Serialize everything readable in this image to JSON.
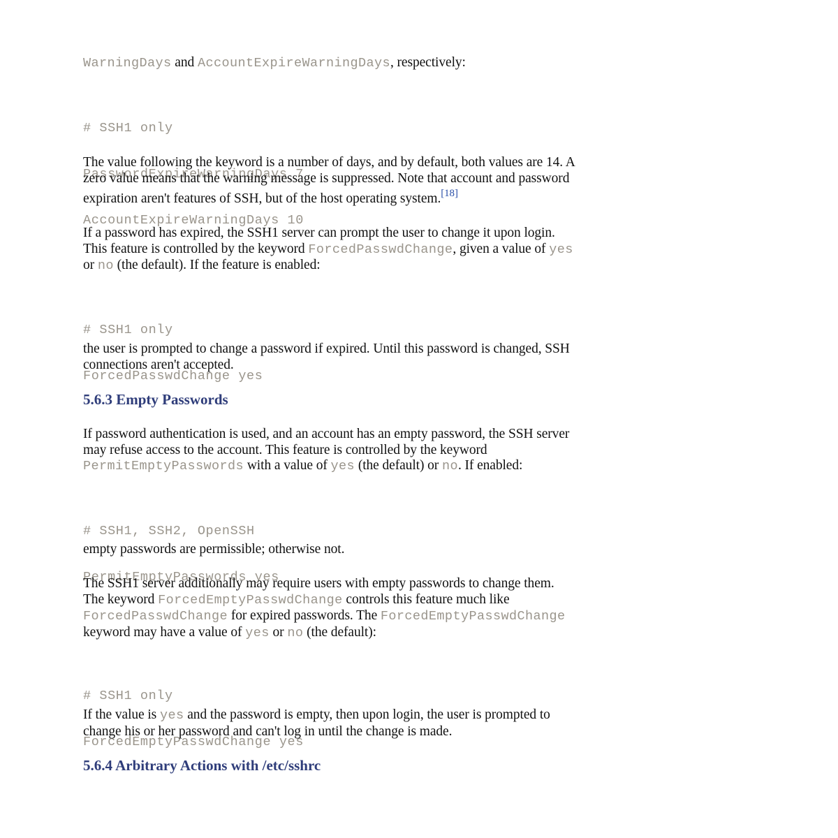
{
  "document": {
    "intro_line": {
      "kw1": "WarningDays",
      "t1": " and ",
      "kw2": "AccountExpireWarningDays",
      "t2": ", respectively:"
    },
    "code1": [
      "# SSH1 only",
      "PasswordExpireWarningDays 7",
      "AccountExpireWarningDays 10"
    ],
    "para1": {
      "lines": [
        "The value following the keyword is a number of days, and by default, both values are 14. A",
        "zero value means that the warning message is suppressed. Note that account and password",
        "expiration aren't features of SSH, but of the host operating system."
      ],
      "footnote": "[18]"
    },
    "para2": {
      "l1": "If a password has expired, the SSH1 server can prompt the user to change it upon login.",
      "l2a": "This feature is controlled by the keyword ",
      "l2kw": "ForcedPasswdChange",
      "l2b": ", given a value of ",
      "l2yes": "yes",
      "l3a": "or ",
      "l3no": "no",
      "l3b": " (the default). If the feature is enabled:"
    },
    "code2": [
      "# SSH1 only",
      "ForcedPasswdChange yes"
    ],
    "para3": [
      "the user is prompted to change a password if expired. Until this password is changed, SSH",
      "connections aren't accepted."
    ],
    "heading1": "5.6.3 Empty Passwords",
    "para4": {
      "l1": "If password authentication is used, and an account has an empty password, the SSH server",
      "l2": "may refuse access to the account. This feature is controlled by the keyword",
      "l3kw": "PermitEmptyPasswords",
      "l3a": " with a value of ",
      "l3yes": "yes",
      "l3b": " (the default) or ",
      "l3no": "no",
      "l3c": ". If enabled:"
    },
    "code3": [
      "# SSH1, SSH2, OpenSSH",
      "PermitEmptyPasswords yes"
    ],
    "para5": "empty passwords are permissible; otherwise not.",
    "para6": {
      "l1": "The SSH1 server additionally may require users with empty passwords to change them.",
      "l2a": "The keyword ",
      "l2kw": "ForcedEmptyPasswdChange",
      "l2b": " controls this feature much like",
      "l3kw1": "ForcedPasswdChange",
      "l3a": " for expired passwords. The ",
      "l3kw2": "ForcedEmptyPasswdChange",
      "l4a": "keyword may have a value of ",
      "l4yes": "yes",
      "l4b": " or ",
      "l4no": "no",
      "l4c": " (the default):"
    },
    "code4": [
      "# SSH1 only",
      "ForcedEmptyPasswdChange yes"
    ],
    "para7": {
      "l1a": "If the value is ",
      "l1yes": "yes",
      "l1b": " and the password is empty, then upon login, the user is prompted to",
      "l2": "change his or her password and can't log in until the change is made."
    },
    "heading2": "5.6.4 Arbitrary Actions with /etc/sshrc"
  },
  "colors": {
    "code": "#9a958c",
    "heading": "#2f3d7a",
    "footnote": "#2a4fa8",
    "text": "#111111"
  }
}
